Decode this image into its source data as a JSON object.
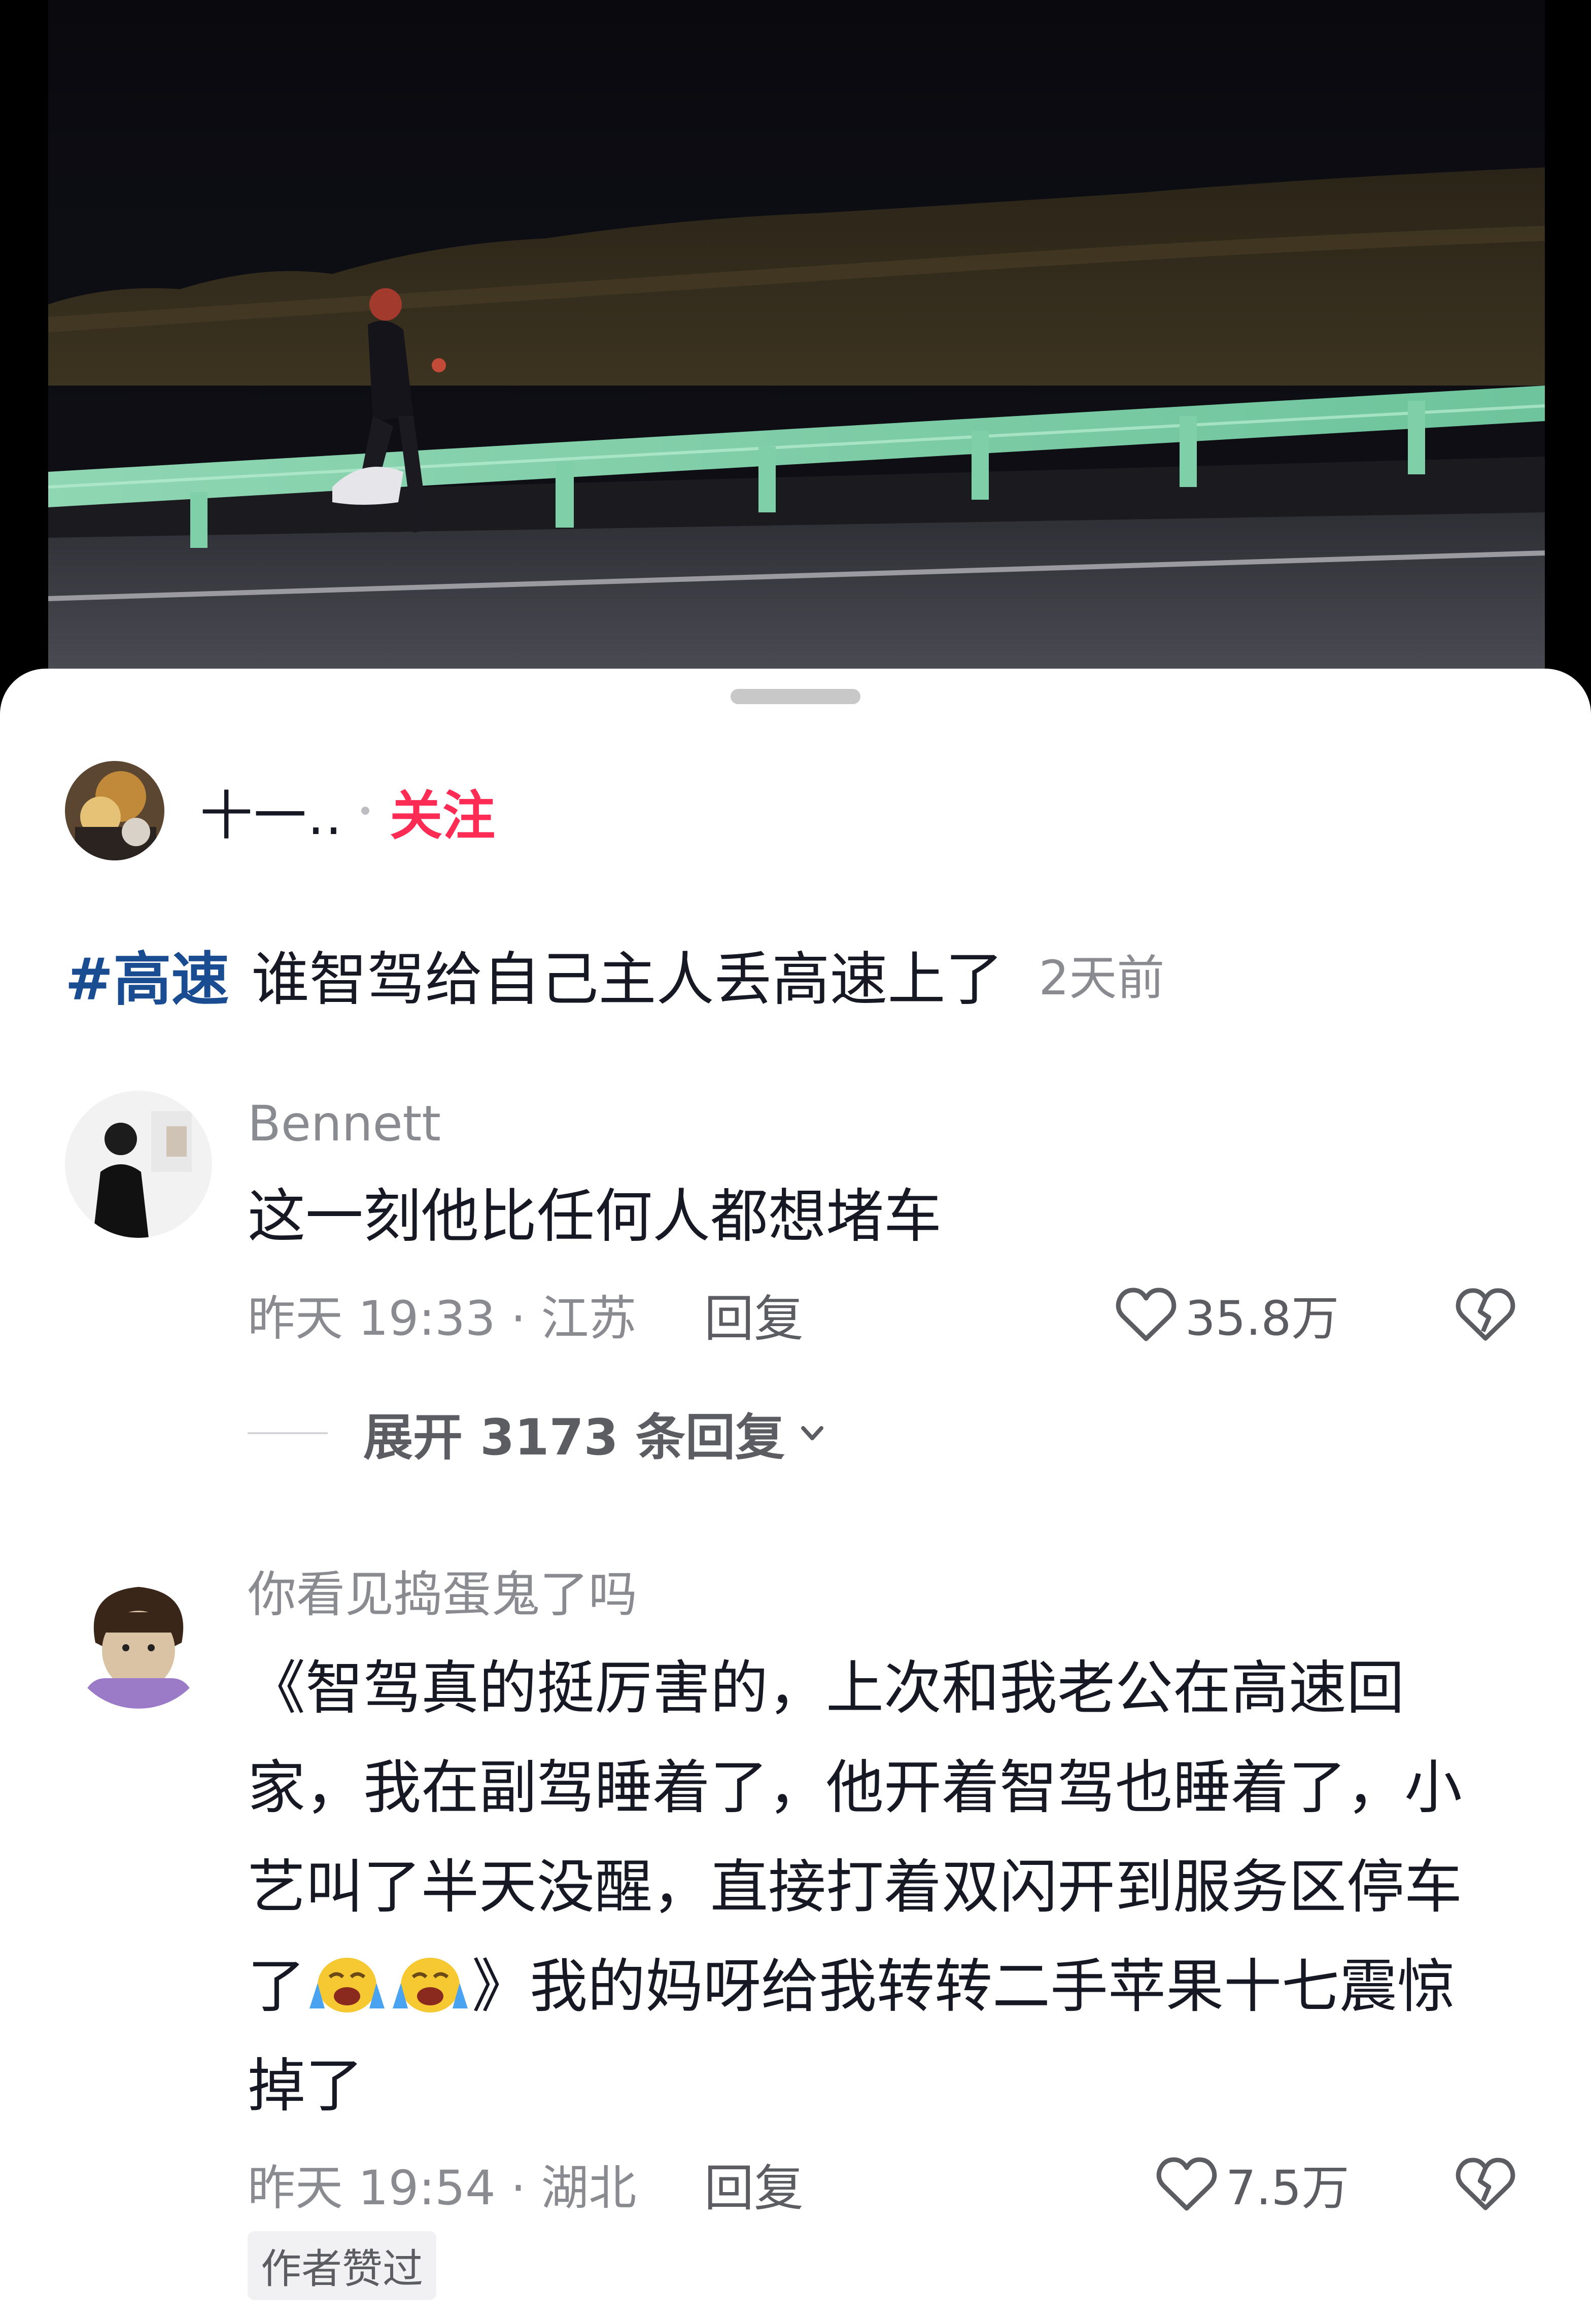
{
  "post": {
    "author_name": "十一..",
    "follow_label": "关注",
    "hashtag": "#高速",
    "caption": "谁智驾给自己主人丢高速上了",
    "time": "2天前"
  },
  "comments": [
    {
      "username": "Bennett",
      "text_lines": [
        "这一刻他比任何人都想堵车"
      ],
      "time_location": "昨天 19:33 · 江苏",
      "reply_label": "回复",
      "like_count": "35.8万",
      "expand_label": "展开 3173 条回复"
    },
    {
      "username": "你看见捣蛋鬼了吗",
      "text_lines": [
        "《智驾真的挺厉害的，上次和我老公在高速回",
        "家，我在副驾睡着了，他开着智驾也睡着了，小",
        "艺叫了半天没醒，直接打着双闪开到服务区停车",
        "了",
        "》我的妈呀给我转转二手苹果十七震惊",
        "掉了"
      ],
      "emoji": [
        "loudly-crying-face",
        "loudly-crying-face"
      ],
      "time_location": "昨天 19:54 · 湖北",
      "reply_label": "回复",
      "like_count": "7.5万",
      "badge": "作者赞过"
    }
  ],
  "icons": {
    "like": "heart-outline-icon",
    "dislike": "broken-heart-icon",
    "expand": "chevron-down-icon"
  },
  "colors": {
    "follow": "#fe2c55",
    "hashtag": "#1a4c92",
    "text_primary": "#161823",
    "text_secondary": "#8a8b91",
    "guardrail": "#7fcfa8"
  }
}
